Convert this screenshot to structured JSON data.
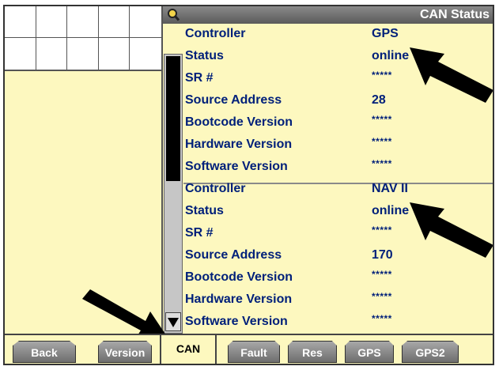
{
  "header": {
    "title": "CAN Status",
    "icon": "magnifier-icon"
  },
  "controllers": [
    {
      "rows": [
        {
          "label": "Controller",
          "value": "GPS"
        },
        {
          "label": "Status",
          "value": "online"
        },
        {
          "label": "SR #",
          "value": "*****"
        },
        {
          "label": "Source Address",
          "value": "28"
        },
        {
          "label": "Bootcode Version",
          "value": "*****"
        },
        {
          "label": "Hardware Version",
          "value": "*****"
        },
        {
          "label": "Software Version",
          "value": "*****"
        }
      ]
    },
    {
      "rows": [
        {
          "label": "Controller",
          "value": "NAV II"
        },
        {
          "label": "Status",
          "value": "online"
        },
        {
          "label": "SR #",
          "value": "*****"
        },
        {
          "label": "Source Address",
          "value": "170"
        },
        {
          "label": "Bootcode Version",
          "value": "*****"
        },
        {
          "label": "Hardware Version",
          "value": "*****"
        },
        {
          "label": "Software Version",
          "value": "*****"
        }
      ]
    }
  ],
  "tabs": [
    {
      "label": "Back",
      "active": false
    },
    {
      "label": "Version",
      "active": false
    },
    {
      "label": "CAN",
      "active": true
    },
    {
      "label": "Fault",
      "active": false
    },
    {
      "label": "Res",
      "active": false
    },
    {
      "label": "GPS",
      "active": false
    },
    {
      "label": "GPS2",
      "active": false
    }
  ],
  "colors": {
    "background": "#fdf8bf",
    "text": "#00207a",
    "header": "#6e6e6e"
  }
}
